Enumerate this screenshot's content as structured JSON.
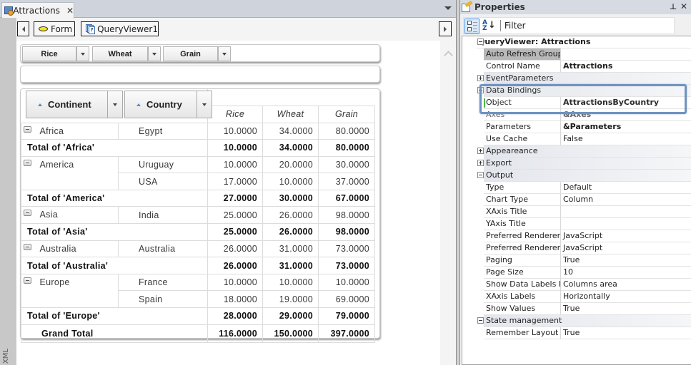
{
  "document": {
    "tab_title": "Attractions",
    "side_label": "XML",
    "nav": {
      "form_label": "Form",
      "queryviewer_label": "QueryViewer1"
    }
  },
  "pivot": {
    "data_fields": [
      "Rice",
      "Wheat",
      "Grain"
    ],
    "row_fields": [
      "Continent",
      "Country"
    ],
    "measures": [
      "Rice",
      "Wheat",
      "Grain"
    ],
    "rows": [
      {
        "type": "detail",
        "continent": "Africa",
        "country": "Egypt",
        "values": [
          "10.0000",
          "34.0000",
          "80.0000"
        ]
      },
      {
        "type": "total",
        "label": "Total of 'Africa'",
        "values": [
          "10.0000",
          "34.0000",
          "80.0000"
        ]
      },
      {
        "type": "detail",
        "continent": "America",
        "country": "Uruguay",
        "values": [
          "10.0000",
          "20.0000",
          "30.0000"
        ]
      },
      {
        "type": "detail-cont",
        "country": "USA",
        "values": [
          "17.0000",
          "10.0000",
          "37.0000"
        ]
      },
      {
        "type": "total",
        "label": "Total of 'America'",
        "values": [
          "27.0000",
          "30.0000",
          "67.0000"
        ]
      },
      {
        "type": "detail",
        "continent": "Asia",
        "country": "India",
        "values": [
          "25.0000",
          "26.0000",
          "98.0000"
        ]
      },
      {
        "type": "total",
        "label": "Total of 'Asia'",
        "values": [
          "25.0000",
          "26.0000",
          "98.0000"
        ]
      },
      {
        "type": "detail",
        "continent": "Australia",
        "country": "Australia",
        "values": [
          "26.0000",
          "31.0000",
          "73.0000"
        ]
      },
      {
        "type": "total",
        "label": "Total of 'Australia'",
        "values": [
          "26.0000",
          "31.0000",
          "73.0000"
        ]
      },
      {
        "type": "detail",
        "continent": "Europe",
        "country": "France",
        "values": [
          "10.0000",
          "10.0000",
          "10.0000"
        ]
      },
      {
        "type": "detail-cont",
        "country": "Spain",
        "values": [
          "18.0000",
          "19.0000",
          "69.0000"
        ]
      },
      {
        "type": "total",
        "label": "Total of 'Europe'",
        "values": [
          "28.0000",
          "29.0000",
          "79.0000"
        ]
      }
    ],
    "grand_total": {
      "label": "Grand Total",
      "values": [
        "116.0000",
        "150.0000",
        "397.0000"
      ]
    }
  },
  "properties": {
    "title": "Properties",
    "filter_label": "Filter",
    "object_header": "QueryViewer: Attractions",
    "rows": [
      {
        "kind": "prop",
        "name": "Auto Refresh Group",
        "value": "",
        "selected": true
      },
      {
        "kind": "prop",
        "name": "Control Name",
        "value": "Attractions",
        "bold": true
      },
      {
        "kind": "cat",
        "name": "EventParameters",
        "expanded": false
      },
      {
        "kind": "cat",
        "name": "Data Bindings",
        "expanded": true
      },
      {
        "kind": "prop",
        "name": "Object",
        "value": "AttractionsByCountry",
        "bold": true,
        "marker": true
      },
      {
        "kind": "prop",
        "name": "Axes",
        "value": "&Axes",
        "bold": true,
        "cut": true
      },
      {
        "kind": "prop",
        "name": "Parameters",
        "value": "&Parameters",
        "bold": true
      },
      {
        "kind": "prop",
        "name": "Use Cache",
        "value": "False"
      },
      {
        "kind": "cat",
        "name": "Appeareance",
        "expanded": false
      },
      {
        "kind": "cat",
        "name": "Export",
        "expanded": false
      },
      {
        "kind": "cat",
        "name": "Output",
        "expanded": true
      },
      {
        "kind": "prop",
        "name": "Type",
        "value": "Default"
      },
      {
        "kind": "prop",
        "name": "Chart Type",
        "value": "Column"
      },
      {
        "kind": "prop",
        "name": "XAxis Title",
        "value": ""
      },
      {
        "kind": "prop",
        "name": "YAxis Title",
        "value": ""
      },
      {
        "kind": "prop",
        "name": "Preferred Renderer F",
        "value": "JavaScript"
      },
      {
        "kind": "prop",
        "name": "Preferred Renderer F",
        "value": "JavaScript"
      },
      {
        "kind": "prop",
        "name": "Paging",
        "value": "True"
      },
      {
        "kind": "prop",
        "name": "Page Size",
        "value": "10"
      },
      {
        "kind": "prop",
        "name": "Show Data Labels In",
        "value": "Columns area"
      },
      {
        "kind": "prop",
        "name": "XAxis Labels",
        "value": "Horizontally"
      },
      {
        "kind": "prop",
        "name": "Show Values",
        "value": "True"
      },
      {
        "kind": "cat",
        "name": "State management",
        "expanded": true
      },
      {
        "kind": "prop",
        "name": "Remember Layout",
        "value": "True"
      }
    ]
  }
}
